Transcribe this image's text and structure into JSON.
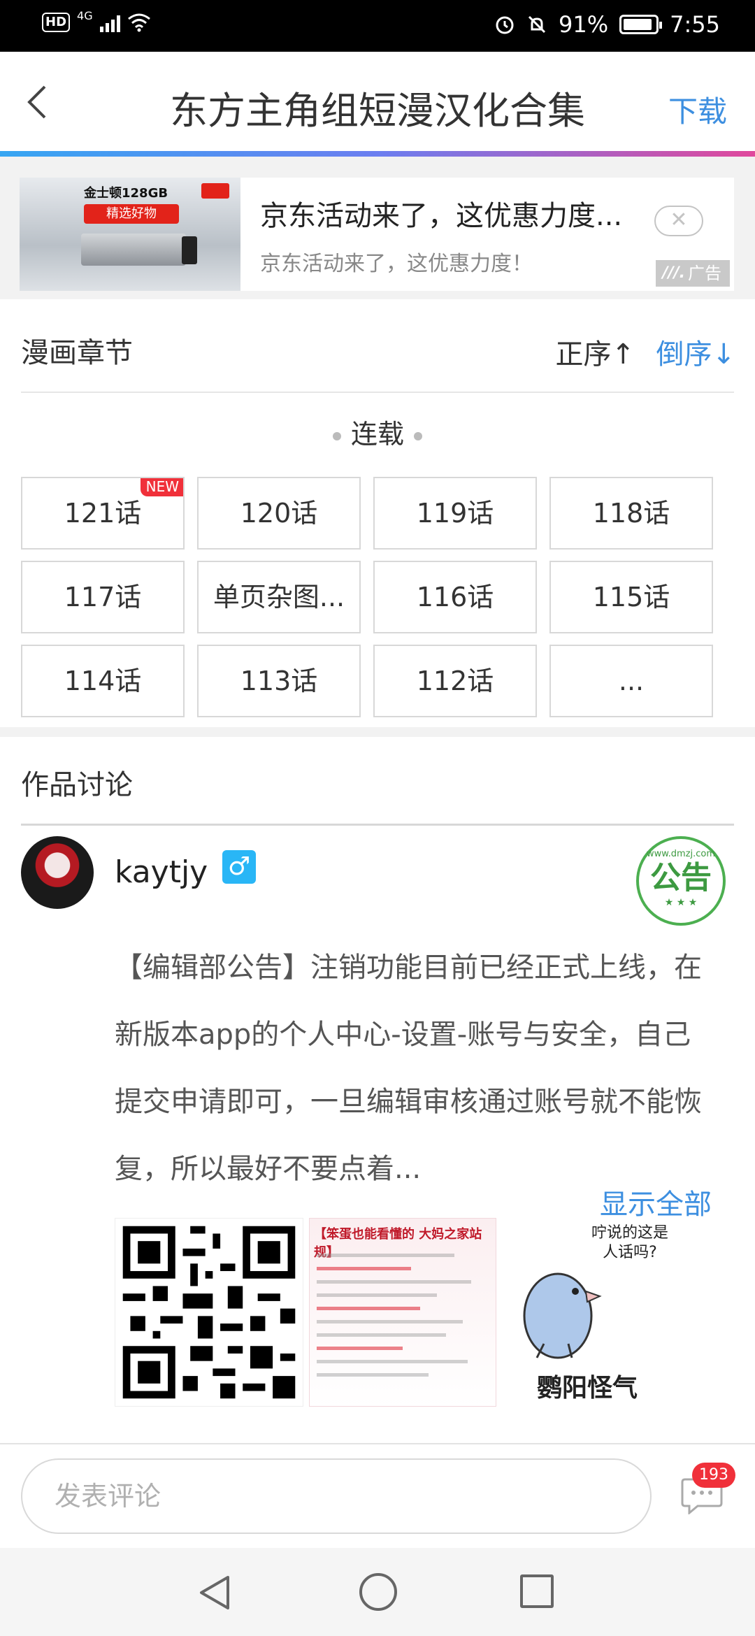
{
  "status_bar": {
    "hd": "HD",
    "network": "4G",
    "battery": "91%",
    "time": "7:55"
  },
  "header": {
    "title": "东方主角组短漫汉化合集",
    "download_label": "下载"
  },
  "ad": {
    "brand_text": "金士顿128GB",
    "tag_text": "精选好物",
    "title": "京东活动来了，这优惠力度...",
    "description": "京东活动来了，这优惠力度！",
    "close_symbol": "✕",
    "badge_label": "广告"
  },
  "chapters": {
    "section_title": "漫画章节",
    "sort_asc_label": "正序↑",
    "sort_desc_label": "倒序↓",
    "serial_label": "连载",
    "new_badge": "NEW",
    "items": [
      {
        "label": "121话"
      },
      {
        "label": "120话"
      },
      {
        "label": "119话"
      },
      {
        "label": "118话"
      },
      {
        "label": "117话"
      },
      {
        "label": "单页杂图..."
      },
      {
        "label": "116话"
      },
      {
        "label": "115话"
      },
      {
        "label": "114话"
      },
      {
        "label": "113话"
      },
      {
        "label": "112话"
      },
      {
        "label": "..."
      }
    ]
  },
  "discussion": {
    "section_title": "作品讨论",
    "post": {
      "username": "kaytjy",
      "gender_symbol": "♂",
      "seal_site": "www.dmzj.com",
      "seal_text": "公告",
      "text": "【编辑部公告】注销功能目前已经正式上线，在新版本app的个人中心-设置-账号与安全，自己提交申请即可，一旦编辑审核通过账号就不能恢复，所以最好不要点着...",
      "show_all_label": "显示全部",
      "rules_image_title": "【笨蛋也能看懂的 大妈之家站规】",
      "meme_bubble": "咛说的这是人话吗?",
      "meme_caption": "鹦阳怪气"
    }
  },
  "bottom_bar": {
    "comment_placeholder": "发表评论",
    "comment_count": "193"
  },
  "colors": {
    "accent_blue": "#3d8fe0",
    "badge_red": "#f0303a",
    "gender_blue": "#29b6f6"
  }
}
